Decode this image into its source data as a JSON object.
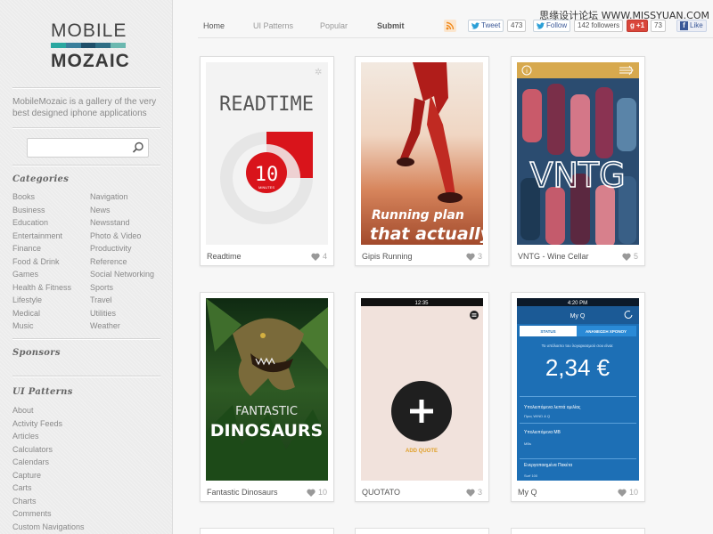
{
  "watermark": "思缘设计论坛 WWW.MISSYUAN.COM",
  "logo": {
    "line1": "MOBILE",
    "line2": "MOZAIC",
    "colors": [
      "#2aa7a0",
      "#3a7f9c",
      "#1f4f6a",
      "#2f6e85",
      "#6bb8b0"
    ]
  },
  "tagline": "MobileMozaic is a gallery of the very best designed iphone applications",
  "search": {
    "placeholder": ""
  },
  "categories": {
    "title": "Categories",
    "col1": [
      "Books",
      "Business",
      "Education",
      "Entertainment",
      "Finance",
      "Food & Drink",
      "Games",
      "Health & Fitness",
      "Lifestyle",
      "Medical",
      "Music"
    ],
    "col2": [
      "Navigation",
      "News",
      "Newsstand",
      "Photo & Video",
      "Productivity",
      "Reference",
      "Social Networking",
      "Sports",
      "Travel",
      "Utilities",
      "Weather"
    ]
  },
  "sponsors": {
    "title": "Sponsors"
  },
  "ui_patterns": {
    "title": "UI Patterns",
    "items": [
      "About",
      "Activity Feeds",
      "Articles",
      "Calculators",
      "Calendars",
      "Capture",
      "Carts",
      "Charts",
      "Comments",
      "Custom Navigations"
    ]
  },
  "nav": {
    "home": "Home",
    "ui_patterns": "UI Patterns",
    "popular": "Popular",
    "submit": "Submit"
  },
  "social": {
    "tweet": "Tweet",
    "tweet_count": "473",
    "follow": "Follow",
    "followers": "142 followers",
    "gplus": "+1",
    "gplus_count": "73",
    "like": "Like"
  },
  "cards": [
    {
      "title": "Readtime",
      "likes": "4",
      "screen": {
        "heading": "READTIME",
        "number": "10",
        "unit": "MINUTES"
      }
    },
    {
      "title": "Gipis Running",
      "likes": "3",
      "screen": {
        "line1": "Running plan",
        "line2": "that actually"
      }
    },
    {
      "title": "VNTG - Wine Cellar",
      "likes": "5",
      "screen": {
        "logo": "VNTG"
      }
    },
    {
      "title": "Fantastic Dinosaurs",
      "likes": "10",
      "screen": {
        "line1": "FANTASTIC",
        "line2": "DINOSAURS"
      }
    },
    {
      "title": "QUOTATO",
      "likes": "3",
      "screen": {
        "time": "12:35",
        "action": "ADD QUOTE"
      }
    },
    {
      "title": "My Q",
      "likes": "10",
      "screen": {
        "time": "4:20 PM",
        "header": "My Q",
        "tab1": "STATUS",
        "tab2": "ΑΝΑΝΕΩΣΗ ΧΡΟΝΟΥ",
        "caption": "Το υπόλοιπο του λογαριασμού σου είναι:",
        "balance": "2,34 €",
        "r1": "Υπολειπόμενα λεπτά ομιλίας",
        "r2": "Προς WIND & Q",
        "r3": "Υπολειπόμενα MB",
        "r4": "MBs",
        "r5": "Ενεργοποιημένα Πακέτα",
        "r6": "Surf 100"
      }
    }
  ],
  "colors": {
    "readtime_red": "#d9141b",
    "vntg_bg": "#d7a94e",
    "myq_blue": "#1d6fb5",
    "quotato_bg": "#f1e2dc"
  }
}
